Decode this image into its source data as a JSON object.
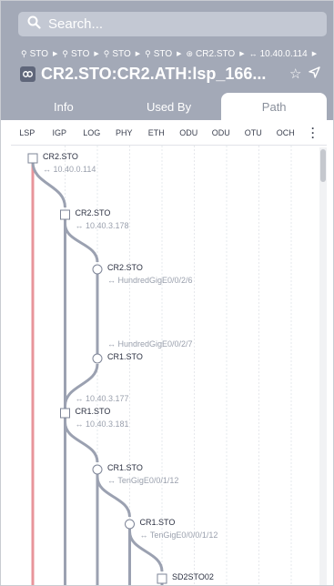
{
  "search": {
    "placeholder": "Search..."
  },
  "breadcrumb": [
    {
      "icon": "location-pin-icon",
      "text": "STO"
    },
    {
      "icon": "location-pin-icon",
      "text": "STO"
    },
    {
      "icon": "location-pin-icon",
      "text": "STO"
    },
    {
      "icon": "location-pin-icon",
      "text": "STO"
    },
    {
      "icon": "router-icon",
      "text": "CR2.STO"
    },
    {
      "icon": "link-arrows-icon",
      "text": "10.40.0.114"
    }
  ],
  "title": "CR2.STO:CR2.ATH:lsp_166...",
  "tabs": [
    {
      "label": "Info"
    },
    {
      "label": "Used By"
    },
    {
      "label": "Path"
    }
  ],
  "active_tab": "Path",
  "layers": [
    "LSP",
    "IGP",
    "LOG",
    "PHY",
    "ETH",
    "ODU",
    "ODU",
    "OTU",
    "OCH"
  ],
  "path": [
    {
      "kind": "square",
      "col": 0,
      "name": "CR2.STO",
      "detail": "10.40.0.114",
      "detail_pos": "below"
    },
    {
      "kind": "square",
      "col": 1,
      "name": "CR2.STO",
      "detail": "10.40.3.178",
      "detail_pos": "below"
    },
    {
      "kind": "circle",
      "col": 2,
      "name": "CR2.STO",
      "detail": "HundredGigE0/0/2/6",
      "detail_pos": "below"
    },
    {
      "kind": "circle",
      "col": 2,
      "name": "CR1.STO",
      "detail": "HundredGigE0/0/2/7",
      "detail_pos": "above"
    },
    {
      "kind": "square",
      "col": 1,
      "name": "CR1.STO",
      "detail_above": "10.40.3.177",
      "detail": "10.40.3.181",
      "detail_pos": "both"
    },
    {
      "kind": "circle",
      "col": 2,
      "name": "CR1.STO",
      "detail": "TenGigE0/0/1/12",
      "detail_pos": "below"
    },
    {
      "kind": "circle",
      "col": 3,
      "name": "CR1.STO",
      "detail": "TenGigE0/0/0/1/12",
      "detail_pos": "below"
    },
    {
      "kind": "square",
      "col": 4,
      "name": "SD2STO02",
      "detail": "",
      "detail_pos": "none"
    }
  ],
  "colors": {
    "header": "#a3a9b7",
    "lsp_line": "#e8959b",
    "path_line": "#9ba1b1",
    "node_stroke": "#7e8597"
  }
}
